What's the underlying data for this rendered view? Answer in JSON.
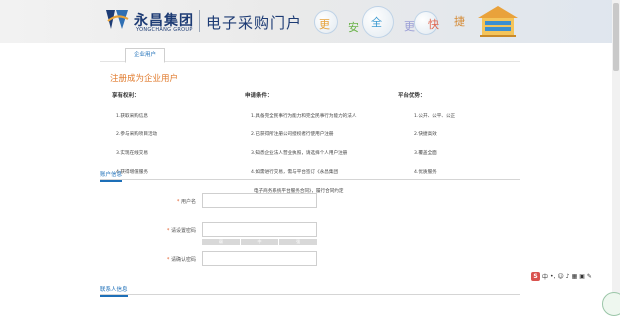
{
  "header": {
    "brand_cn": "永昌集团",
    "brand_en": "YONGCHANG GROUP",
    "portal_title": "电子采购门户",
    "slogan": [
      "更",
      "安",
      "全",
      "更",
      "快",
      "捷"
    ],
    "colors": {
      "brand_blue": "#1d3b74",
      "accent_blue": "#1d6fb8",
      "orange": "#e07a2c"
    }
  },
  "tabs": [
    {
      "label": "企业用户",
      "active": true
    }
  ],
  "register": {
    "title": "注册成为企业用户",
    "columns": [
      {
        "heading": "享有权利：",
        "items": [
          "1.获取采购信息",
          "2.参与采购项目活动",
          "3.实现在线交易",
          "4.获得增值服务"
        ]
      },
      {
        "heading": "申请条件：",
        "items": [
          "1.具备完全民事行为能力和完全民事行为能力的法人",
          "2.已获得所注册公司授权者行使用户注册",
          "3.知悉企业法人营业执照，请选择个人用户注册",
          "4.如需进行交易，需与平台签订《永昌集团",
          "  电子商务系统平台服务合同》，履行合同约定"
        ]
      },
      {
        "heading": "平台优势：",
        "items": [
          "1.公开、公平、公正",
          "2.快捷高效",
          "3.覆盖全面",
          "4.优质服务"
        ]
      }
    ]
  },
  "sections": {
    "account": "账户信息",
    "contact": "联系人信息"
  },
  "form": {
    "required_mark": "*",
    "username_label": "用户名",
    "password_label": "请设置密码",
    "confirm_label": "请确认密码",
    "username_value": "",
    "password_value": "",
    "confirm_value": "",
    "strength": [
      "弱",
      "中",
      "强"
    ]
  },
  "ime": {
    "icon": "sogou-ime-icon",
    "lang": "中"
  }
}
